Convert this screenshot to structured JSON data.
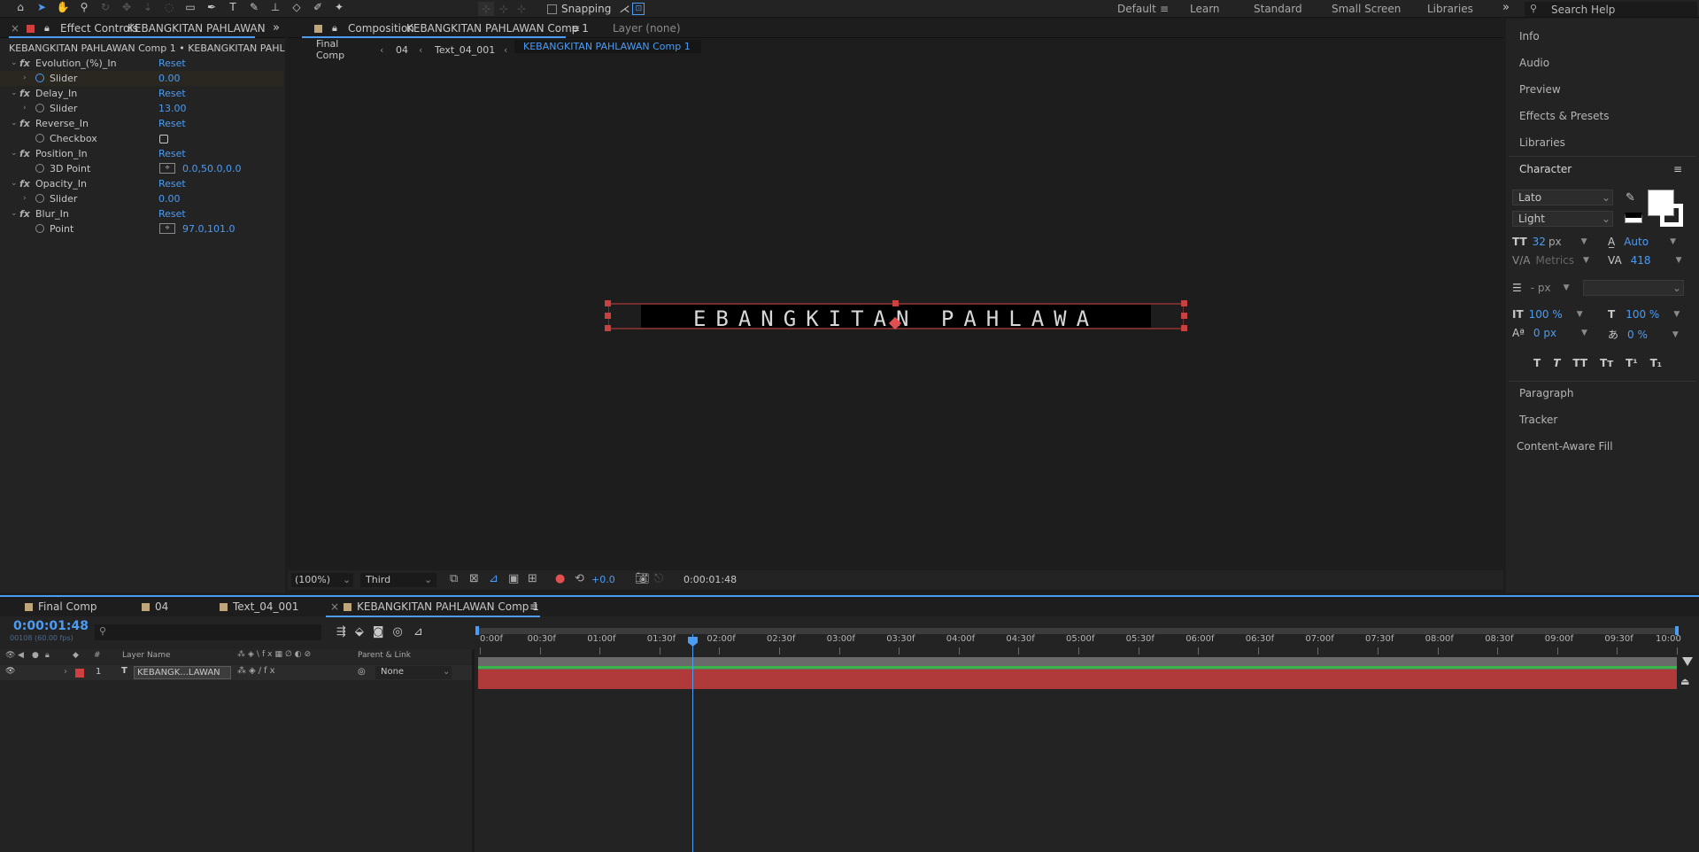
{
  "toolbar": {
    "snapping_label": "Snapping",
    "workspaces": [
      "Default",
      "Learn",
      "Standard",
      "Small Screen",
      "Libraries"
    ],
    "active_workspace": "Default",
    "search_placeholder": "Search Help"
  },
  "effect_controls": {
    "tab_label": "Effect Controls",
    "tab_layer": "KEBANGKITAN PAHLAWAN",
    "subtitle": "KEBANGKITAN PAHLAWAN Comp 1 • KEBANGKITAN PAHLAWA",
    "reset_label": "Reset",
    "effects": [
      {
        "name": "Evolution_(%)_In",
        "param": "Slider",
        "value": "0.00"
      },
      {
        "name": "Delay_In",
        "param": "Slider",
        "value": "13.00"
      },
      {
        "name": "Reverse_In",
        "param": "Checkbox",
        "value": ""
      },
      {
        "name": "Position_In",
        "param": "3D Point",
        "value": "0.0,50.0,0.0"
      },
      {
        "name": "Opacity_In",
        "param": "Slider",
        "value": "0.00"
      },
      {
        "name": "Blur_In",
        "param": "Point",
        "value": "97.0,101.0"
      }
    ]
  },
  "composition": {
    "tab_label": "Composition",
    "tab_comp": "KEBANGKITAN PAHLAWAN Comp 1",
    "layer_tab": "Layer (none)",
    "breadcrumbs": [
      "Final Comp",
      "04",
      "Text_04_001",
      "KEBANGKITAN PAHLAWAN Comp 1"
    ],
    "preview_text": "EBANGKITAN PAHLAWA",
    "zoom": "(100%)",
    "resolution": "Third",
    "exposure": "+0.0",
    "timecode": "0:00:01:48"
  },
  "right_panel": {
    "items_top": [
      "Info",
      "Audio",
      "Preview",
      "Effects & Presets",
      "Libraries"
    ],
    "character_title": "Character",
    "font_family": "Lato",
    "font_style": "Light",
    "font_size": "32",
    "font_size_unit": "px",
    "leading": "Auto",
    "kerning": "Metrics",
    "tracking": "418",
    "stroke_width": "- px",
    "vert_scale": "100 %",
    "horiz_scale": "100 %",
    "baseline_shift": "0 px",
    "tsume": "0 %",
    "text_styles": [
      "T",
      "T",
      "TT",
      "Tт",
      "T¹",
      "T₁"
    ],
    "items_bottom": [
      "Paragraph",
      "Tracker",
      "Content-Aware Fill"
    ]
  },
  "timeline": {
    "tabs": [
      "Final Comp",
      "04",
      "Text_04_001",
      "KEBANGKITAN PAHLAWAN Comp 1"
    ],
    "timecode": "0:00:01:48",
    "frame_info": "00108 (60.00 fps)",
    "col_layer_name": "Layer Name",
    "col_parent": "Parent & Link",
    "layer": {
      "index": "1",
      "name": "KEBANGK...LAWAN",
      "parent": "None"
    },
    "ruler_labels": [
      "0:00f",
      "00:30f",
      "01:00f",
      "01:30f",
      "02:00f",
      "02:30f",
      "03:00f",
      "03:30f",
      "04:00f",
      "04:30f",
      "05:00f",
      "05:30f",
      "06:00f",
      "06:30f",
      "07:00f",
      "07:30f",
      "08:00f",
      "08:30f",
      "09:00f",
      "09:30f",
      "10:00"
    ]
  },
  "colors": {
    "accent": "#4b9cf5",
    "layer_red": "#b03a3a",
    "green_bar": "#39b54a",
    "swatch_tan": "#bfa57a"
  }
}
